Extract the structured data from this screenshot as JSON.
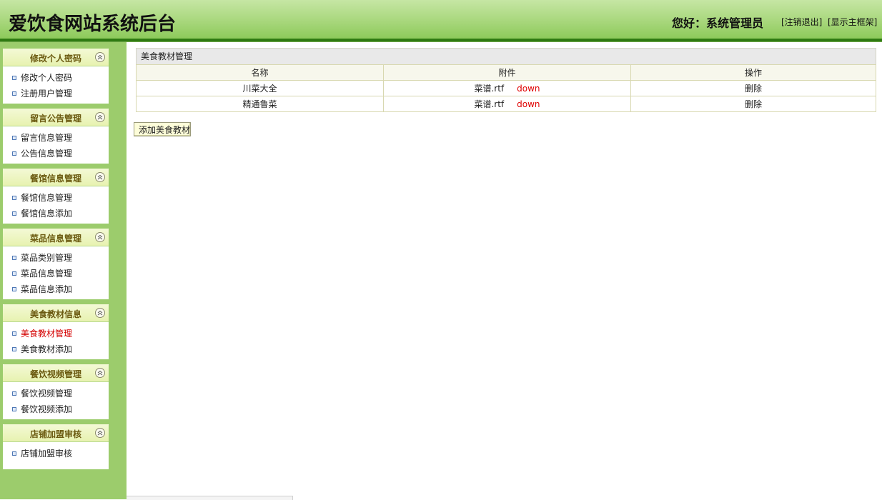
{
  "header": {
    "site_title": "爱饮食网站系统后台",
    "greeting": "您好：系统管理员",
    "logout_label": "[注销退出]",
    "show_frame_label": "[显示主框架]"
  },
  "sidebar": {
    "panels": [
      {
        "title": "修改个人密码",
        "items": [
          "修改个人密码",
          "注册用户管理"
        ]
      },
      {
        "title": "留言公告管理",
        "items": [
          "留言信息管理",
          "公告信息管理"
        ]
      },
      {
        "title": "餐馆信息管理",
        "items": [
          "餐馆信息管理",
          "餐馆信息添加"
        ]
      },
      {
        "title": "菜品信息管理",
        "items": [
          "菜品类别管理",
          "菜品信息管理",
          "菜品信息添加"
        ]
      },
      {
        "title": "美食教材信息",
        "items": [
          "美食教材管理",
          "美食教材添加"
        ]
      },
      {
        "title": "餐饮视频管理",
        "items": [
          "餐饮视频管理",
          "餐饮视频添加"
        ]
      },
      {
        "title": "店铺加盟审核",
        "items": [
          "店铺加盟审核"
        ]
      }
    ],
    "active_item": "美食教材管理"
  },
  "main": {
    "panel_title": "美食教材管理",
    "columns": [
      "名称",
      "附件",
      "操作"
    ],
    "rows": [
      {
        "name": "川菜大全",
        "file": "菜谱.rtf",
        "download": "down",
        "action": "删除"
      },
      {
        "name": "精通鲁菜",
        "file": "菜谱.rtf",
        "download": "down",
        "action": "删除"
      }
    ],
    "add_button_label": "添加美食教材"
  },
  "colors": {
    "header_green": "#a8d77c",
    "header_bar": "#2f7a12",
    "sidebar_bg": "#9ccc6c",
    "active_link": "#d40000",
    "download_link": "#e00000"
  }
}
